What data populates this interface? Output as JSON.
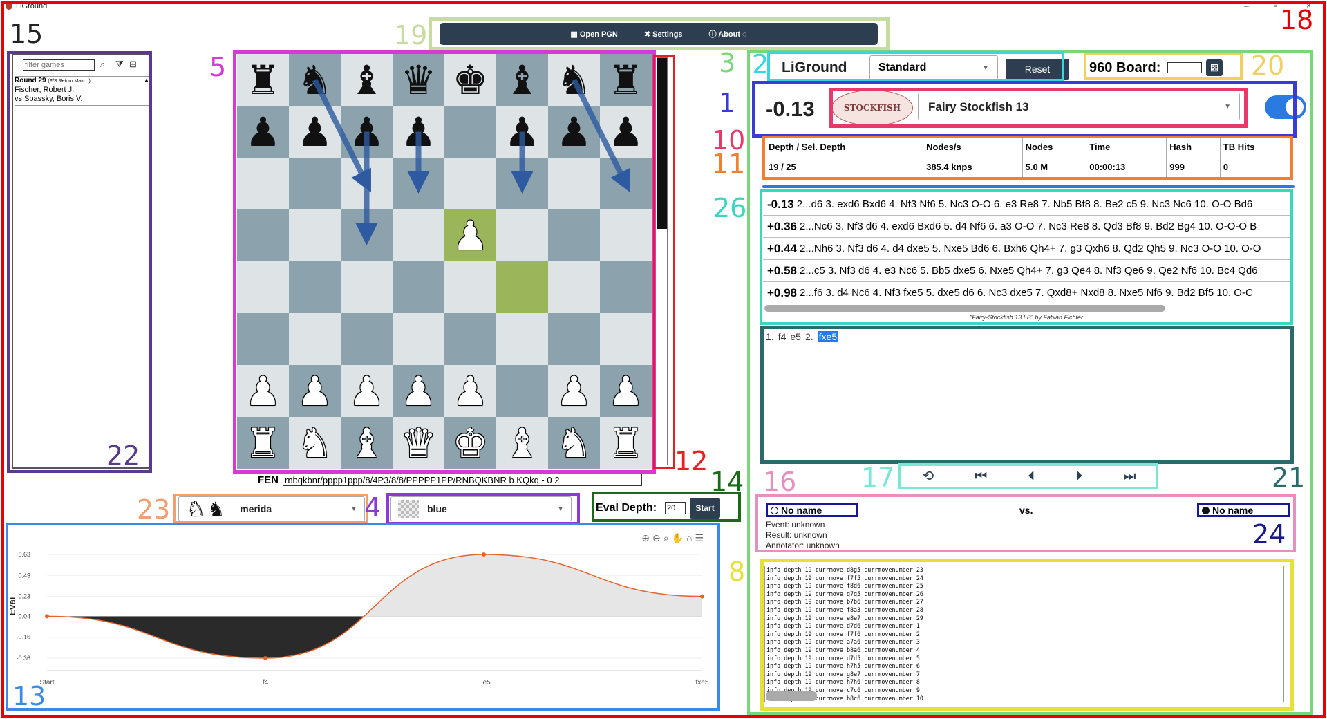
{
  "window": {
    "title": "LiGround",
    "controls": [
      "–",
      "▫",
      "×"
    ]
  },
  "menu": [
    {
      "icon": "▦",
      "label": "Open PGN"
    },
    {
      "icon": "✖",
      "label": "Settings"
    },
    {
      "icon": "ⓘ",
      "label": "About"
    }
  ],
  "game_list": {
    "filter_placeholder": "filter games",
    "group": "Round 29",
    "group_detail": "(F/S Return Matc...)",
    "games": [
      {
        "white": "Fischer, Robert J.",
        "black": "vs Spassky, Boris V."
      }
    ]
  },
  "board": {
    "rows": [
      [
        "r",
        "n",
        "b",
        "q",
        "k",
        "b",
        "n",
        "r"
      ],
      [
        "p",
        "p",
        "p",
        "p",
        "",
        "p",
        "p",
        "p"
      ],
      [
        "",
        "",
        "",
        "",
        "",
        "",
        "",
        ""
      ],
      [
        "",
        "",
        "",
        "",
        "P",
        "",
        "",
        ""
      ],
      [
        "",
        "",
        "",
        "",
        "",
        "",
        "",
        ""
      ],
      [
        "",
        "",
        "",
        "",
        "",
        "",
        "",
        ""
      ],
      [
        "P",
        "P",
        "P",
        "P",
        "P",
        "",
        "P",
        "P"
      ],
      [
        "R",
        "N",
        "B",
        "Q",
        "K",
        "B",
        "N",
        "R"
      ]
    ],
    "highlight": [
      [
        3,
        4
      ],
      [
        4,
        5
      ]
    ],
    "arrows": [
      {
        "from": [
          0,
          1
        ],
        "to": [
          2,
          2
        ]
      },
      {
        "from": [
          1,
          2
        ],
        "to": [
          3,
          2
        ]
      },
      {
        "from": [
          1,
          3
        ],
        "to": [
          2,
          3
        ]
      },
      {
        "from": [
          1,
          5
        ],
        "to": [
          2,
          5
        ]
      },
      {
        "from": [
          0,
          6
        ],
        "to": [
          2,
          7
        ]
      }
    ],
    "eval_bar_black_fraction": 0.42
  },
  "fen": {
    "label": "FEN",
    "value": "rnbqkbnr/pppp1ppp/8/4P3/8/8/PPPPP1PP/RNBQKBNR b KQkq - 0 2"
  },
  "piece_style": {
    "value": "merida"
  },
  "board_style": {
    "value": "blue"
  },
  "eval_depth": {
    "label": "Eval Depth:",
    "value": "20",
    "button": "Start"
  },
  "chart_data": {
    "type": "area",
    "categories": [
      "Start",
      "f4",
      "...e5",
      "fxe5"
    ],
    "values": [
      0.04,
      -0.36,
      0.63,
      0.23
    ],
    "ylabel": "Eval",
    "ytick_labels": [
      "0.63",
      "0.43",
      "0.23",
      "0.04",
      "-0.16",
      "-0.36"
    ],
    "line_color": "#e8622c",
    "fill_positive": "#e6e6e6",
    "fill_negative": "#2a2a2a"
  },
  "header": {
    "app_name": "LiGround",
    "mode": "Standard",
    "reset": "Reset",
    "board960_label": "960 Board:"
  },
  "engine": {
    "score": "-0.13",
    "logo_text": "STOCKFISH",
    "name": "Fairy Stockfish 13",
    "enabled": true
  },
  "stats": {
    "headers": [
      "Depth / Sel. Depth",
      "Nodes/s",
      "Nodes",
      "Time",
      "Hash",
      "TB Hits"
    ],
    "values": [
      "19 / 25",
      "385.4 knps",
      "5.0 M",
      "00:00:13",
      "999",
      "0"
    ]
  },
  "pv_lines": [
    {
      "score": "-0.13",
      "moves": "2...d6 3. exd6 Bxd6 4. Nf3 Nf6 5. Nc3 O-O 6. e3 Re8 7. Nb5 Bf8 8. Be2 c5 9. Nc3 Nc6 10. O-O Bd6"
    },
    {
      "score": "+0.36",
      "moves": "2...Nc6 3. Nf3 d6 4. exd6 Bxd6 5. d4 Nf6 6. a3 O-O 7. Nc3 Re8 8. Qd3 Bf8 9. Bd2 Bg4 10. O-O-O B"
    },
    {
      "score": "+0.44",
      "moves": "2...Nh6 3. Nf3 d6 4. d4 dxe5 5. Nxe5 Bd6 6. Bxh6 Qh4+ 7. g3 Qxh6 8. Qd2 Qh5 9. Nc3 O-O 10. O-O"
    },
    {
      "score": "+0.58",
      "moves": "2...c5 3. Nf3 d6 4. e3 Nc6 5. Bb5 dxe5 6. Nxe5 Qh4+ 7. g3 Qe4 8. Nf3 Qe6 9. Qe2 Nf6 10. Bc4 Qd6"
    },
    {
      "score": "+0.98",
      "moves": "2...f6 3. d4 Nc6 4. Nf3 fxe5 5. dxe5 d6 6. Nc3 dxe5 7. Qxd8+ Nxd8 8. Nxe5 Nf6 9. Bd2 Bf5 10. O-C"
    }
  ],
  "engine_credit": "\"Fairy-Stockfish 13 LB\" by Fabian Fichter",
  "moves": [
    "1.",
    "f4",
    "e5",
    "2.",
    "fxe5"
  ],
  "current_move_index": 4,
  "nav": [
    "⟲",
    "⏮",
    "⏴",
    "⏵",
    "⏭"
  ],
  "players": {
    "white": "No name",
    "black": "No name",
    "vs": "vs.",
    "event": "Event: unknown",
    "result": "Result: unknown",
    "annotator": "Annotator: unknown"
  },
  "engine_output": [
    "info depth 19 currmove d8g5 currmovenumber 23",
    "info depth 19 currmove f7f5 currmovenumber 24",
    "info depth 19 currmove f8d6 currmovenumber 25",
    "info depth 19 currmove g7g5 currmovenumber 26",
    "info depth 19 currmove b7b6 currmovenumber 27",
    "info depth 19 currmove f8a3 currmovenumber 28",
    "info depth 19 currmove e8e7 currmovenumber 29",
    "info depth 19 currmove d7d6 currmovenumber 1",
    "info depth 19 currmove f7f6 currmovenumber 2",
    "info depth 19 currmove a7a6 currmovenumber 3",
    "info depth 19 currmove b8a6 currmovenumber 4",
    "info depth 19 currmove d7d5 currmovenumber 5",
    "info depth 19 currmove h7h5 currmovenumber 6",
    "info depth 19 currmove g8e7 currmovenumber 7",
    "info depth 19 currmove h7h6 currmovenumber 8",
    "info depth 19 currmove c7c6 currmovenumber 9",
    "info depth 19 currmove b8c6 currmovenumber 10"
  ],
  "annotation_boxes": [
    {
      "n": "1",
      "color": "#3a3ad6"
    },
    {
      "n": "2",
      "color": "#3ad6e0"
    },
    {
      "n": "3",
      "color": "#7ad67a"
    },
    {
      "n": "4",
      "color": "#8a3ad6"
    },
    {
      "n": "5",
      "color": "#d63ad6"
    },
    {
      "n": "8",
      "color": "#e6e03a"
    },
    {
      "n": "10",
      "color": "#e63a6a"
    },
    {
      "n": "11",
      "color": "#f08030"
    },
    {
      "n": "12",
      "color": "#e62020"
    },
    {
      "n": "13",
      "color": "#3a8ae6"
    },
    {
      "n": "14",
      "color": "#1a6a1a"
    },
    {
      "n": "15",
      "color": "#222222"
    },
    {
      "n": "16",
      "color": "#e690c0"
    },
    {
      "n": "17",
      "color": "#7ae6d6"
    },
    {
      "n": "18",
      "color": "#e60000"
    },
    {
      "n": "19",
      "color": "#c6dca0"
    },
    {
      "n": "20",
      "color": "#f0d060"
    },
    {
      "n": "21",
      "color": "#2a6a6a"
    },
    {
      "n": "22",
      "color": "#5a3a8a"
    },
    {
      "n": "23",
      "color": "#f0a070"
    },
    {
      "n": "24",
      "color": "#1a1a8a"
    },
    {
      "n": "26",
      "color": "#3ad6c0"
    }
  ]
}
